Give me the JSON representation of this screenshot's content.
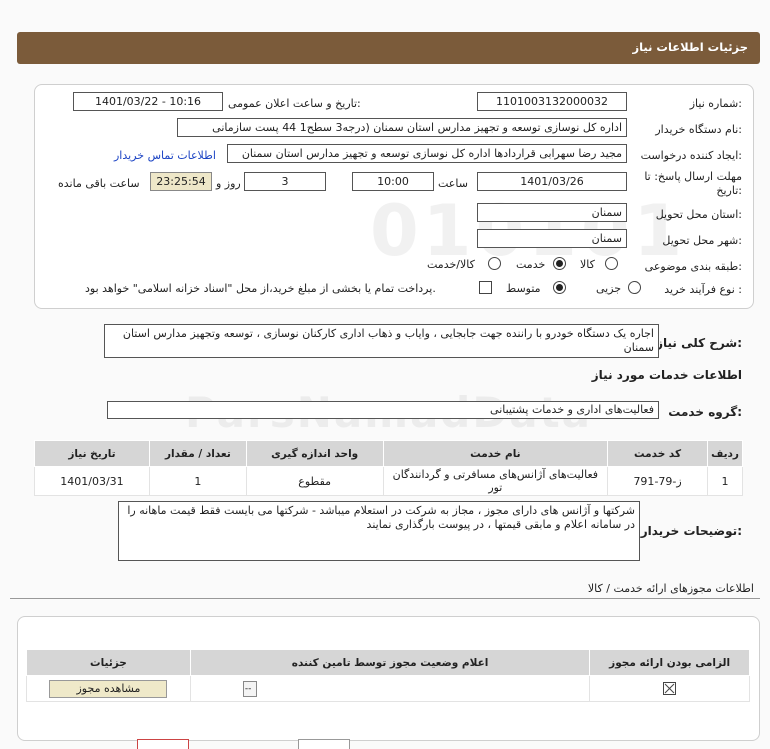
{
  "header": {
    "title": "جزئیات اطلاعات نیاز"
  },
  "form": {
    "need_number_label": "شماره نیاز:",
    "need_number": "1101003132000032",
    "announce_label": "تاریخ و ساعت اعلان عمومی:",
    "announce_value": "1401/03/22 - 10:16",
    "buyer_label": "نام دستگاه خریدار:",
    "buyer_value": "اداره کل نوسازی   توسعه و تجهیز مدارس استان سمنان (درجه3  سطح1  44 پست سازمانی",
    "creator_label": "ایجاد کننده درخواست:",
    "creator_value": "مجید رضا سهرابی قراردادها اداره کل نوسازی   توسعه و تجهیز مدارس استان سمنان",
    "contact_link": "اطلاعات تماس خریدار",
    "deadline_label_1": "مهلت ارسال پاسخ: تا",
    "deadline_label_2": "تاریخ:",
    "deadline_date": "1401/03/26",
    "time_label": "ساعت",
    "deadline_time": "10:00",
    "days_value": "3",
    "days_label": "روز و",
    "remaining_value": "23:25:54",
    "remaining_label": "ساعت باقی مانده",
    "province_label": "استان محل تحویل:",
    "province_value": "سمنان",
    "city_label": "شهر محل تحویل:",
    "city_value": "سمنان",
    "category_label": "طبقه بندی موضوعی:",
    "category_options": [
      "کالا",
      "خدمت",
      "کالا/خدمت"
    ],
    "category_selected": "خدمت",
    "process_label": "نوع فرآیند خرید :",
    "process_options": [
      "جزیی",
      "متوسط"
    ],
    "process_selected": "متوسط",
    "payment_note": "پرداخت تمام یا بخشی از مبلغ خرید،از محل \"اسناد خزانه اسلامی\" خواهد بود."
  },
  "summary": {
    "label": "شرح کلی نیاز:",
    "text": "اجاره یک دستگاه خودرو با راننده جهت جابجایی ، وایاب و ذهاب اداری کارکنان نوسازی ، توسعه وتجهیز مدارس استان سمنان"
  },
  "services": {
    "section_title": "اطلاعات خدمات مورد نیاز",
    "group_label": "گروه خدمت:",
    "group_value": "فعالیت‌های اداری و خدمات پشتیبانی",
    "columns": [
      "ردیف",
      "کد خدمت",
      "نام خدمت",
      "واحد اندازه گیری",
      "تعداد / مقدار",
      "تاریخ نیاز"
    ],
    "rows": [
      [
        "1",
        "ز-79-791",
        "فعالیت‌های آژانس‌های مسافرتی و گردانندگان تور",
        "مقطوع",
        "1",
        "1401/03/31"
      ]
    ]
  },
  "buyer_notes": {
    "label": "توضیحات خریدار:",
    "text": "شرکتها و آژانس های دارای مجوز ، مجاز به شرکت در استعلام میباشد - شرکتها می بایست فقط قیمت ماهانه را در سامانه اعلام و مابقی قیمتها ، در پیوست بارگذاری نمایند"
  },
  "permits": {
    "title": "اطلاعات مجوزهای ارائه خدمت / کالا",
    "columns": [
      "الزامی بودن ارائه مجوز",
      "اعلام وضعیت مجوز توسط تامین کننده",
      "جزئیات"
    ],
    "view_button": "مشاهده مجوز",
    "select_placeholder": "--"
  }
}
